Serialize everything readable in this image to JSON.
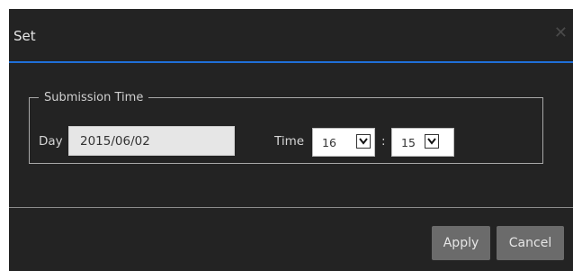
{
  "dialog": {
    "title": "Set",
    "close_glyph": "✕"
  },
  "submission": {
    "legend": "Submission Time",
    "day_label": "Day",
    "day_value": "2015/06/02",
    "time_label": "Time",
    "hour_value": "16",
    "separator": ":",
    "minute_value": "15"
  },
  "footer": {
    "apply_label": "Apply",
    "cancel_label": "Cancel"
  },
  "colors": {
    "background": "#232323",
    "accent": "#1f6fd8",
    "button": "#6b6b6b"
  }
}
